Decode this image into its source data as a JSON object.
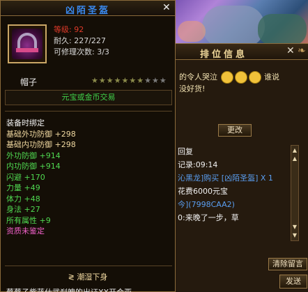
{
  "tooltip": {
    "item_name": "凶陌圣盔",
    "level": "等级: 92",
    "durability": "耐久: 227/227",
    "repairs": "可修理次数: 3/3",
    "slot": "帽子",
    "star_count": 10,
    "stars_filled": 7,
    "trade_text": "元宝或金币交易",
    "bind_text": "装备时绑定",
    "attributes": [
      {
        "label": "基础外功防御 +298",
        "color": "cream"
      },
      {
        "label": "基础内功防御 +298",
        "color": "cream"
      },
      {
        "label": "外功防御 +914",
        "color": "green"
      },
      {
        "label": "内功防御 +914",
        "color": "green"
      },
      {
        "label": "闪避 +170",
        "color": "green"
      },
      {
        "label": "力量 +49",
        "color": "green"
      },
      {
        "label": "体力 +48",
        "color": "green"
      },
      {
        "label": "身法 +27",
        "color": "green"
      },
      {
        "label": "所有属性 +9",
        "color": "green"
      },
      {
        "label": "资质未鉴定",
        "color": "pink"
      }
    ],
    "set_name": "≷ 潮湿下身",
    "bottom_cut_text": "蔡蔡子紫蓝仕武刹魄的出证XX开合亚"
  },
  "rank_panel": {
    "title": "排位信息",
    "msg_line1": "的令人哭泣",
    "msg_line1_tail": "谁说",
    "msg_line2": "没好货!",
    "change_btn": "更改",
    "chat_lines": [
      {
        "text": "回复",
        "cls": "c-white"
      },
      {
        "text": "记录:09:14",
        "cls": "c-white"
      },
      {
        "text": "沁黑龙]购买 [凶陌圣盔] X 1",
        "cls": "c-blue"
      },
      {
        "text": "花费6000元宝",
        "cls": "c-white"
      },
      {
        "text": "今](7998CAA2)",
        "cls": "c-blue"
      },
      {
        "text": "0:来晚了一步，草",
        "cls": "c-white"
      }
    ],
    "clear_btn": "清除留言",
    "send_btn": "发送"
  }
}
